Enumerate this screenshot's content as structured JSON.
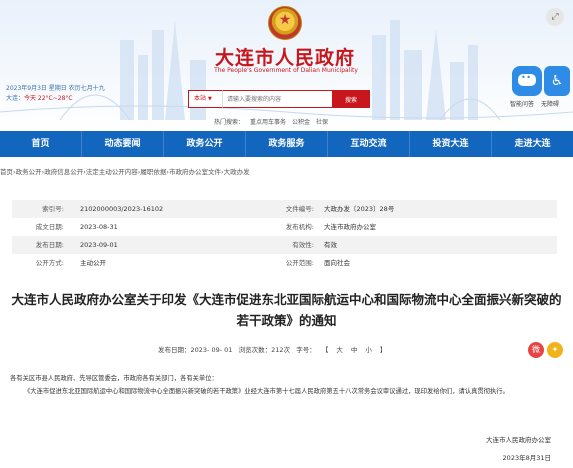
{
  "header": {
    "title": "大连市人民政府",
    "subtitle": "The People's Government of Dalian Municipality",
    "date_line": "2023年9月3日 星期日 农历七月十九",
    "location": "大连：",
    "weather": "今天 22°C~28°C"
  },
  "search": {
    "scope": "本站",
    "placeholder": "请输入要搜索的内容",
    "button": "搜索",
    "hot_label": "热门搜索：",
    "hot_words": [
      "重点用车事务",
      "公积金",
      "社保"
    ]
  },
  "tools": {
    "robot_label": "智能问答",
    "a11y_label": "无障碍",
    "a11y_icon": "accessibility-icon",
    "robot_icon": "robot-icon",
    "corner_icon": "fullscreen-icon"
  },
  "nav": {
    "items": [
      "首页",
      "动态要闻",
      "政务公开",
      "政务服务",
      "互动交流",
      "投资大连",
      "走进大连"
    ]
  },
  "breadcrumb": "首页›政务公开›政府信息公开›法定主动公开内容›履职依据›市政府办公室文件›大政办发",
  "meta": {
    "index_no_label": "索引号:",
    "index_no": "2102000003/2023-16102",
    "doc_no_label": "文件编号:",
    "doc_no": "大政办发〔2023〕28号",
    "written_label": "成文日期:",
    "written": "2023-08-31",
    "issuer_label": "发布机构:",
    "issuer": "大连市政府办公室",
    "published_label": "发布日期:",
    "published": "2023-09-01",
    "validity_label": "有效性:",
    "validity": "有效",
    "method_label": "公开方式:",
    "method": "主动公开",
    "scope_label": "公开范围:",
    "scope": "面向社会"
  },
  "document": {
    "title": "大连市人民政府办公室关于印发《大连市促进东北亚国际航运中心和国际物流中心全面振兴新突破的若干政策》的通知",
    "pub_date_label": "发布日期：",
    "pub_date": "2023- 09- 01",
    "views_label": "浏览次数：",
    "views": "212次",
    "font_label": "字号：",
    "font_open": "【",
    "font_sizes": [
      "大",
      "中",
      "小"
    ],
    "font_close": "】",
    "salutation": "各有关区市县人民政府、先导区管委会，市政府各有关部门，各有关单位：",
    "paragraph": "《大连市促进东北亚国际航运中心和国际物流中心全面振兴新突破的若干政策》业经大连市第十七届人民政府第五十八次常务会议审议通过，现印发给你们，请认真贯彻执行。",
    "sign_org": "大连市人民政府办公室",
    "sign_date": "2023年8月31日"
  },
  "share": {
    "weibo_icon": "weibo-icon",
    "more_icon": "share-icon"
  },
  "colors": {
    "brand_red": "#c8161d",
    "nav_blue": "#1366bd",
    "accent_blue": "#2e8be6"
  }
}
